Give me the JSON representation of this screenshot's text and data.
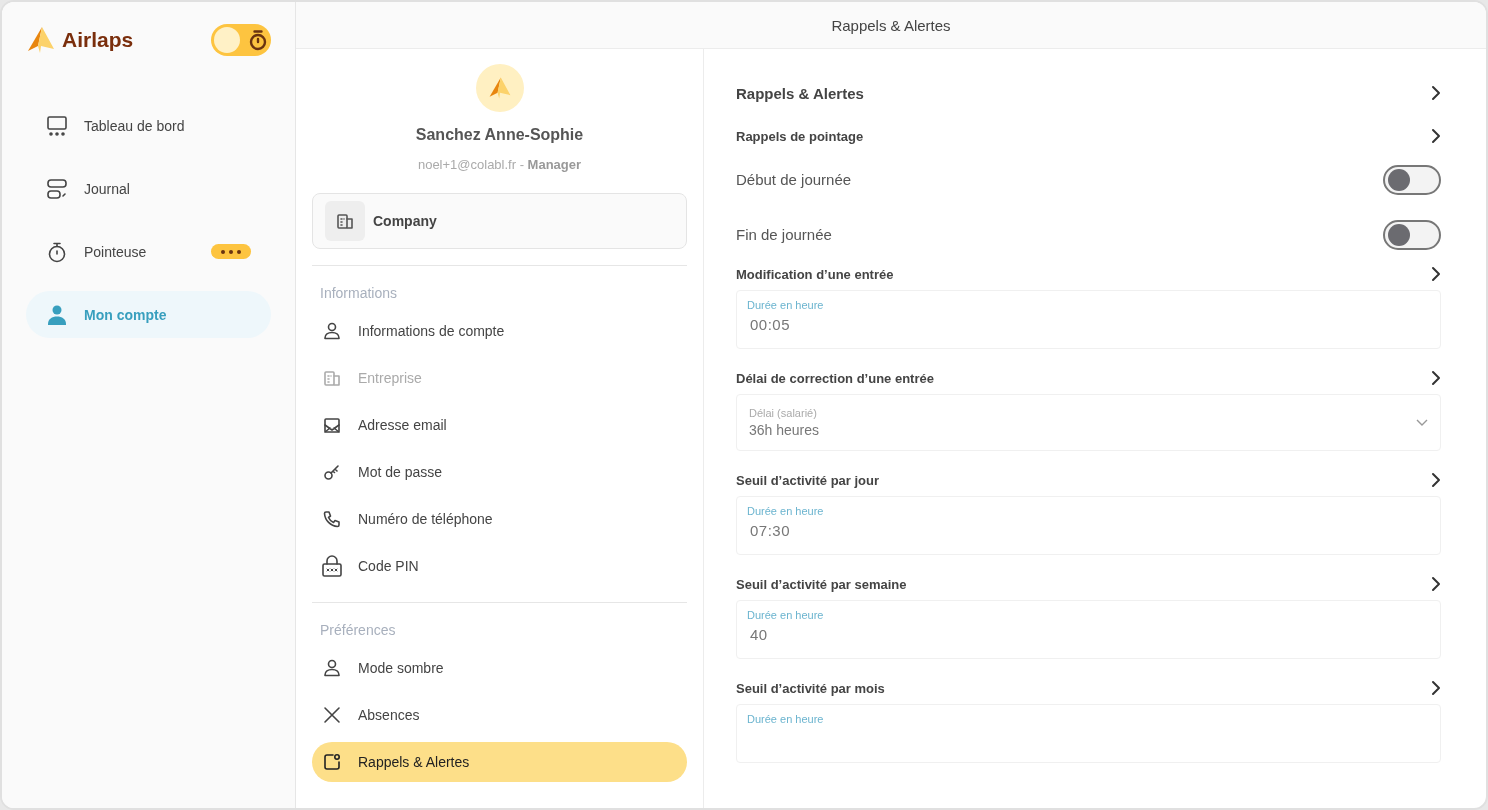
{
  "brand": {
    "name": "Airlaps"
  },
  "timer_toggle": {
    "on": false
  },
  "nav": [
    {
      "label": "Tableau de bord",
      "selected": false,
      "has_badge": false
    },
    {
      "label": "Journal",
      "selected": false,
      "has_badge": false
    },
    {
      "label": "Pointeuse",
      "selected": false,
      "has_badge": true
    },
    {
      "label": "Mon compte",
      "selected": true,
      "has_badge": false
    }
  ],
  "header": {
    "title": "Rappels & Alertes"
  },
  "profile": {
    "name": "Sanchez Anne-Sophie",
    "subtitle": "noel+1@colabl.fr - **Manager**"
  },
  "company": {
    "label": "Company"
  },
  "sections": [
    {
      "title": "Informations",
      "items": [
        {
          "label": "Informations de compte",
          "disabled": false,
          "selected": false
        },
        {
          "label": "Entreprise",
          "disabled": true,
          "selected": false
        },
        {
          "label": "Adresse email",
          "disabled": false,
          "selected": false
        },
        {
          "label": "Mot de passe",
          "disabled": false,
          "selected": false
        },
        {
          "label": "Numéro de téléphone",
          "disabled": false,
          "selected": false
        },
        {
          "label": "Code PIN",
          "disabled": false,
          "selected": false
        }
      ]
    },
    {
      "title": "Préférences",
      "items": [
        {
          "label": "Mode sombre",
          "disabled": false,
          "selected": false
        },
        {
          "label": "Absences",
          "disabled": false,
          "selected": false
        },
        {
          "label": "Rappels & Alertes",
          "disabled": false,
          "selected": true
        }
      ]
    }
  ],
  "settings": [
    {
      "kind": "header",
      "label": "Rappels & Alertes"
    },
    {
      "kind": "link",
      "label": "Rappels de pointage"
    },
    {
      "kind": "toggle",
      "label": "Début de journée",
      "on": false
    },
    {
      "kind": "toggle",
      "label": "Fin de journée",
      "on": false
    },
    {
      "kind": "link",
      "label": "Modification d’une entrée"
    },
    {
      "kind": "field",
      "label": "Durée en heure",
      "value": "00:05"
    },
    {
      "kind": "link",
      "label": "Délai de correction d’une entrée"
    },
    {
      "kind": "select",
      "label": "Délai (salarié)",
      "value": "36h heures"
    },
    {
      "kind": "link",
      "label": "Seuil d’activité par jour"
    },
    {
      "kind": "field",
      "label": "Durée en heure",
      "value": "07:30"
    },
    {
      "kind": "link",
      "label": "Seuil d’activité par semaine"
    },
    {
      "kind": "field",
      "label": "Durée en heure",
      "value": "40"
    },
    {
      "kind": "link",
      "label": "Seuil d’activité par mois"
    },
    {
      "kind": "field",
      "label": "Durée en heure"
    }
  ]
}
